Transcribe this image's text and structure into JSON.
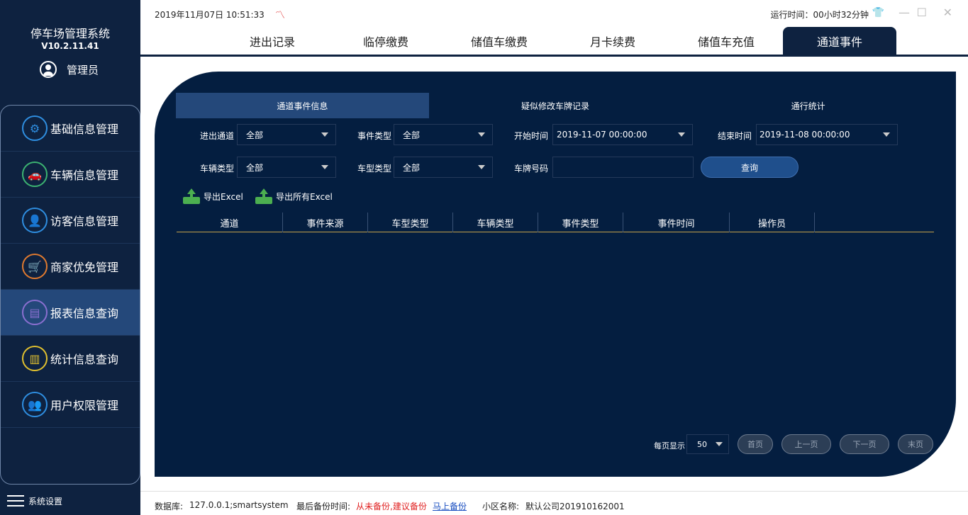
{
  "app": {
    "title": "停车场管理系统",
    "version": "V10.2.11.41",
    "user": "管理员"
  },
  "sidebar": {
    "items": [
      {
        "label": "基础信息管理",
        "color": "#2f8ee0",
        "glyph": "⚙"
      },
      {
        "label": "车辆信息管理",
        "color": "#3cb371",
        "glyph": "🚗"
      },
      {
        "label": "访客信息管理",
        "color": "#2f8ee0",
        "glyph": "👤"
      },
      {
        "label": "商家优免管理",
        "color": "#e07a2f",
        "glyph": "🛒"
      },
      {
        "label": "报表信息查询",
        "color": "#8a6fd0",
        "glyph": "▤"
      },
      {
        "label": "统计信息查询",
        "color": "#e0c02f",
        "glyph": "▥"
      },
      {
        "label": "用户权限管理",
        "color": "#2f8ee0",
        "glyph": "👥"
      }
    ],
    "settings": "系统设置"
  },
  "topbar": {
    "datetime": "2019年11月07日 10:51:33",
    "runtime": "运行时间：00小时32分钟"
  },
  "tabs": [
    "进出记录",
    "临停缴费",
    "储值车缴费",
    "月卡续费",
    "储值车充值",
    "通道事件"
  ],
  "subtabs": [
    "通道事件信息",
    "疑似修改车牌记录",
    "通行统计"
  ],
  "filters": {
    "channel_label": "进出通道",
    "channel_value": "全部",
    "event_type_label": "事件类型",
    "event_type_value": "全部",
    "start_label": "开始时间",
    "start_value": "2019-11-07 00:00:00",
    "end_label": "结束时间",
    "end_value": "2019-11-08 00:00:00",
    "vehicle_type_label": "车辆类型",
    "vehicle_type_value": "全部",
    "car_model_label": "车型类型",
    "car_model_value": "全部",
    "plate_label": "车牌号码",
    "plate_value": "",
    "query_button": "查询"
  },
  "export": {
    "excel": "导出Excel",
    "all_excel": "导出所有Excel"
  },
  "table": {
    "columns": [
      "通道",
      "事件来源",
      "车型类型",
      "车辆类型",
      "事件类型",
      "事件时间",
      "操作员",
      ""
    ]
  },
  "pager": {
    "label": "每页显示",
    "page_size": "50",
    "first": "首页",
    "prev": "上一页",
    "next": "下一页",
    "last": "末页"
  },
  "status": {
    "db_label": "数据库:",
    "db_value": "127.0.0.1;smartsystem",
    "backup_label": "最后备份时间:",
    "backup_value": "从未备份,建议备份",
    "backup_link": "马上备份",
    "community_label": "小区名称:",
    "community_value": "默认公司201910162001"
  }
}
